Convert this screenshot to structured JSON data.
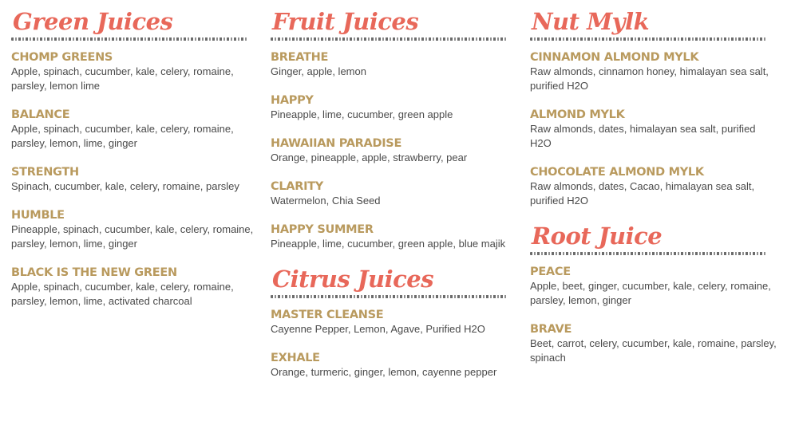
{
  "columns": [
    {
      "sections": [
        {
          "title": "Green Juices",
          "items": [
            {
              "name": "CHOMP GREENS",
              "desc": "Apple, spinach, cucumber, kale, celery, romaine, parsley, lemon lime"
            },
            {
              "name": "BALANCE",
              "desc": "Apple, spinach, cucumber, kale, celery, romaine, parsley, lemon, lime, ginger"
            },
            {
              "name": "STRENGTH",
              "desc": "Spinach, cucumber, kale, celery, romaine, parsley"
            },
            {
              "name": "HUMBLE",
              "desc": "Pineapple, spinach, cucumber, kale, celery, romaine, parsley, lemon, lime, ginger"
            },
            {
              "name": "BLACK IS THE NEW GREEN",
              "desc": "Apple, spinach, cucumber, kale, celery, romaine, parsley, lemon, lime, activated charcoal"
            }
          ]
        }
      ]
    },
    {
      "sections": [
        {
          "title": "Fruit Juices",
          "items": [
            {
              "name": "BREATHE",
              "desc": "Ginger, apple, lemon"
            },
            {
              "name": "HAPPY",
              "desc": "Pineapple, lime, cucumber, green apple"
            },
            {
              "name": "HAWAIIAN PARADISE",
              "desc": "Orange, pineapple, apple, strawberry, pear"
            },
            {
              "name": "CLARITY",
              "desc": "Watermelon, Chia Seed"
            },
            {
              "name": "HAPPY SUMMER",
              "desc": "Pineapple, lime, cucumber, green apple, blue majik"
            }
          ]
        },
        {
          "title": "Citrus Juices",
          "items": [
            {
              "name": "MASTER CLEANSE",
              "desc": "Cayenne Pepper, Lemon, Agave, Purified H2O"
            },
            {
              "name": "EXHALE",
              "desc": "Orange, turmeric, ginger, lemon, cayenne pepper"
            }
          ]
        }
      ]
    },
    {
      "sections": [
        {
          "title": "Nut Mylk",
          "items": [
            {
              "name": "CINNAMON ALMOND MYLK",
              "desc": "Raw almonds, cinnamon honey, himalayan sea salt, purified H2O"
            },
            {
              "name": "ALMOND MYLK",
              "desc": "Raw almonds, dates, himalayan sea salt, purified H2O"
            },
            {
              "name": "CHOCOLATE ALMOND MYLK",
              "desc": "Raw almonds, dates, Cacao, himalayan sea salt, purified H2O"
            }
          ]
        },
        {
          "title": "Root Juice",
          "items": [
            {
              "name": "PEACE",
              "desc": "Apple, beet, ginger, cucumber, kale, celery, romaine, parsley, lemon, ginger"
            },
            {
              "name": "BRAVE",
              "desc": "Beet, carrot, celery, cucumber, kale, romaine, parsley, spinach"
            }
          ]
        }
      ]
    }
  ],
  "colors": {
    "section_title": "#e8685a",
    "item_name": "#b99a5e",
    "item_desc": "#4a4a4a"
  }
}
